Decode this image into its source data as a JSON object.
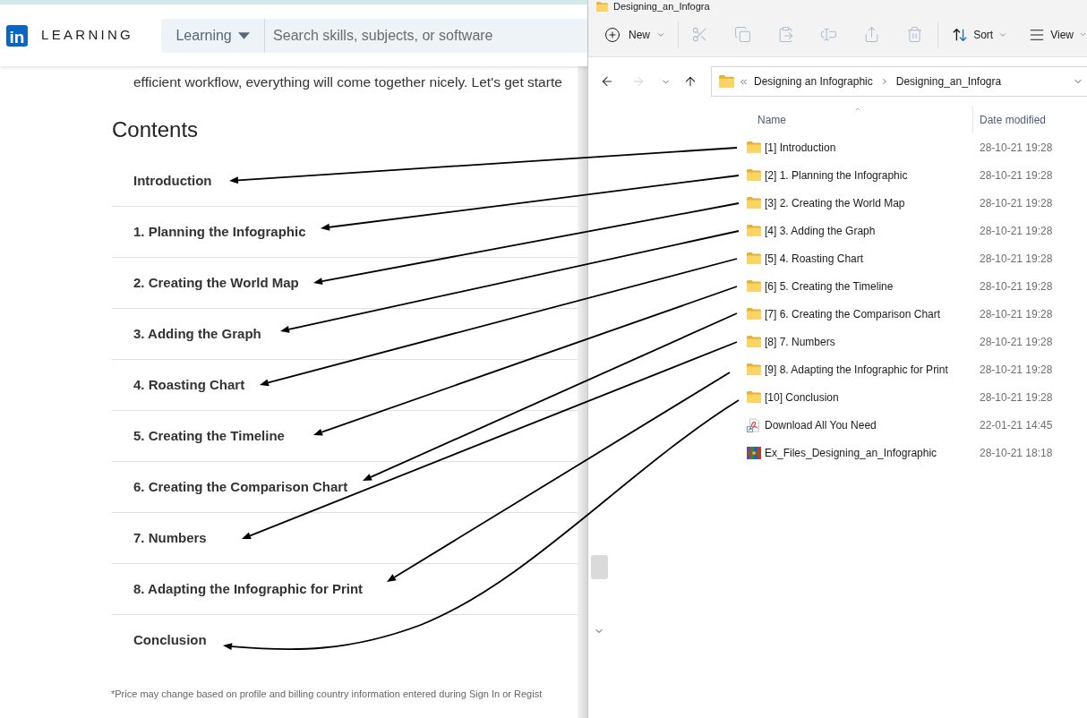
{
  "learning_page": {
    "header": {
      "logo_mark": "in",
      "logo_text": "LEARNING",
      "search_scope": "Learning",
      "search_placeholder": "Search skills, subjects, or software"
    },
    "intro_text": "efficient workflow, everything will come together nicely. Let's get starte",
    "contents": {
      "title": "Contents",
      "items": [
        "Introduction",
        "1. Planning the Infographic",
        "2. Creating the World Map",
        "3. Adding the Graph",
        "4. Roasting Chart",
        "5. Creating the Timeline",
        "6. Creating the Comparison Chart",
        "7. Numbers",
        "8. Adapting the Infographic for Print",
        "Conclusion"
      ]
    },
    "footnote": "*Price may change based on profile and billing country information entered during Sign In or Regist"
  },
  "file_explorer": {
    "title": "Designing_an_Infogra",
    "toolbar": {
      "new": {
        "label": "New"
      },
      "actions": [
        {
          "kind": "cut",
          "disabled": true
        },
        {
          "kind": "copy",
          "disabled": true
        },
        {
          "kind": "paste",
          "disabled": true
        },
        {
          "kind": "rename",
          "disabled": true
        },
        {
          "kind": "share",
          "disabled": true
        },
        {
          "kind": "delete",
          "disabled": true
        }
      ],
      "sort": {
        "label": "Sort"
      },
      "view": {
        "label": "View"
      }
    },
    "navigation": [
      {
        "kind": "back",
        "disabled": false
      },
      {
        "kind": "forward",
        "disabled": true
      },
      {
        "kind": "recent",
        "disabled": false
      },
      {
        "kind": "up",
        "disabled": false
      }
    ],
    "address": {
      "crumbs": [
        "Designing an Infographic",
        "Designing_an_Infogra"
      ]
    },
    "columns": [
      {
        "label": "Name",
        "sorted": true
      },
      {
        "label": "Date modified",
        "sorted": false
      }
    ],
    "rows": [
      {
        "kind": "folder",
        "name": "[1] Introduction",
        "date": "28-10-21 19:28"
      },
      {
        "kind": "folder",
        "name": "[2] 1. Planning the Infographic",
        "date": "28-10-21 19:28"
      },
      {
        "kind": "folder",
        "name": "[3] 2. Creating the World Map",
        "date": "28-10-21 19:28"
      },
      {
        "kind": "folder",
        "name": "[4] 3. Adding the Graph",
        "date": "28-10-21 19:28"
      },
      {
        "kind": "folder",
        "name": "[5] 4. Roasting Chart",
        "date": "28-10-21 19:28"
      },
      {
        "kind": "folder",
        "name": "[6] 5. Creating the Timeline",
        "date": "28-10-21 19:28"
      },
      {
        "kind": "folder",
        "name": "[7] 6. Creating the Comparison Chart",
        "date": "28-10-21 19:28"
      },
      {
        "kind": "folder",
        "name": "[8] 7. Numbers",
        "date": "28-10-21 19:28"
      },
      {
        "kind": "folder",
        "name": "[9] 8. Adapting the Infographic for Print",
        "date": "28-10-21 19:28"
      },
      {
        "kind": "folder",
        "name": "[10] Conclusion",
        "date": "28-10-21 19:28"
      },
      {
        "kind": "shortcut",
        "name": "Download All You Need",
        "date": "22-01-21 14:45"
      },
      {
        "kind": "archive",
        "name": "Ex_Files_Designing_an_Infographic",
        "date": "28-10-21 18:18"
      }
    ]
  }
}
